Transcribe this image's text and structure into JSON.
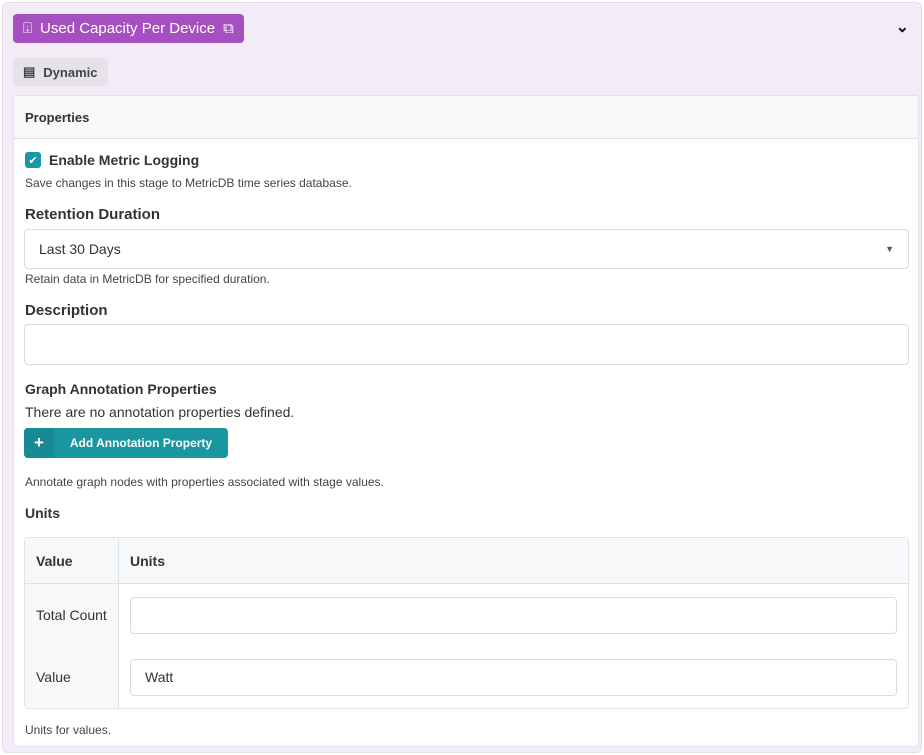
{
  "header": {
    "title": "Used Capacity Per Device",
    "tag": "Dynamic",
    "accent": "#a64fc0"
  },
  "panel": {
    "title": "Properties",
    "metric_logging": {
      "label": "Enable Metric Logging",
      "checked": true,
      "help": "Save changes in this stage to MetricDB time series database."
    },
    "retention": {
      "label": "Retention Duration",
      "value": "Last 30 Days",
      "help": "Retain data in MetricDB for specified duration."
    },
    "description": {
      "label": "Description",
      "value": ""
    },
    "annotations": {
      "label": "Graph Annotation Properties",
      "empty_text": "There are no annotation properties defined.",
      "add_label": "Add Annotation Property",
      "help": "Annotate graph nodes with properties associated with stage values."
    },
    "units": {
      "label": "Units",
      "columns": [
        "Value",
        "Units"
      ],
      "rows": [
        {
          "value": "Total Count",
          "units": ""
        },
        {
          "value": "Value",
          "units": "Watt"
        }
      ],
      "help": "Units for values."
    }
  }
}
